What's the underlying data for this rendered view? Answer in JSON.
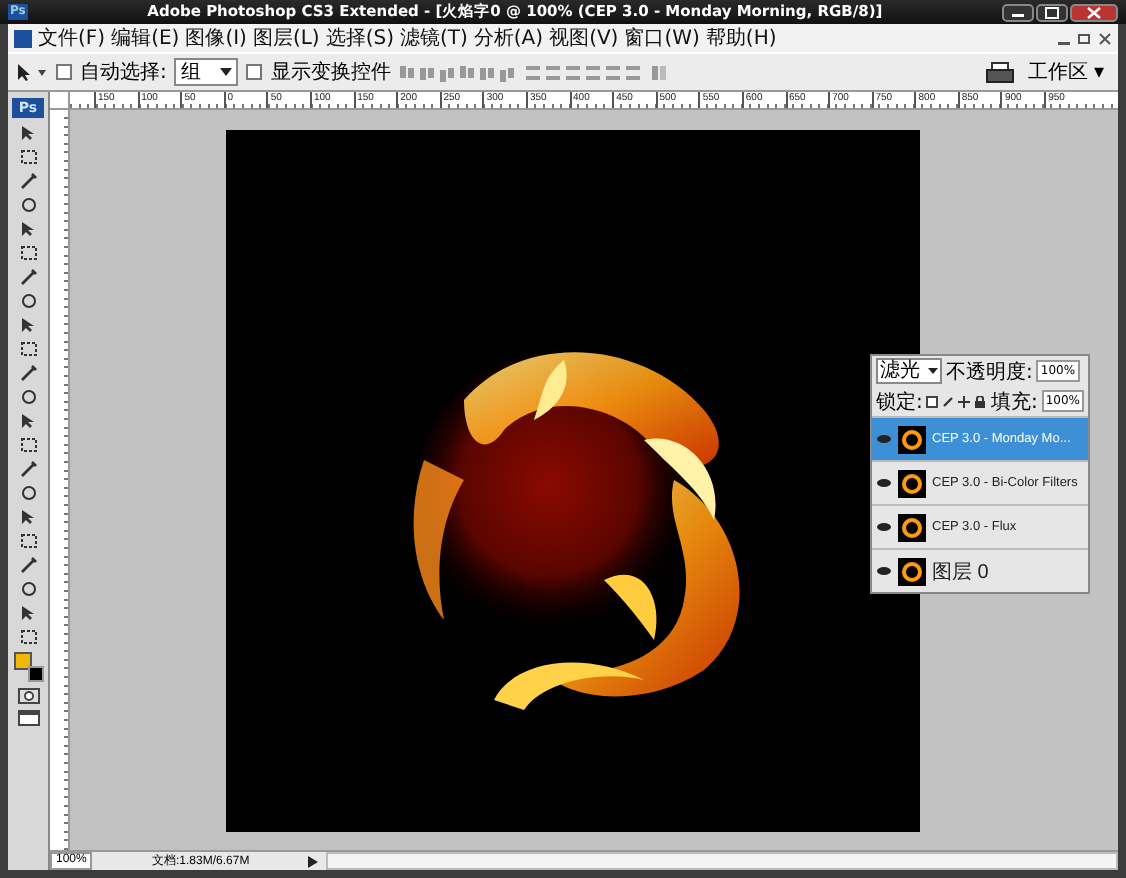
{
  "window": {
    "icon_label": "Ps",
    "title": "Adobe Photoshop CS3 Extended - [火焰字0 @ 100% (CEP 3.0 - Monday Morning, RGB/8)]"
  },
  "menu": [
    "文件(F)",
    "编辑(E)",
    "图像(I)",
    "图层(L)",
    "选择(S)",
    "滤镜(T)",
    "分析(A)",
    "视图(V)",
    "窗口(W)",
    "帮助(H)"
  ],
  "options_bar": {
    "auto_select": {
      "label": "自动选择:",
      "checked": false
    },
    "auto_select_target": "组",
    "show_transform": {
      "label": "显示变换控件",
      "checked": false
    },
    "workspace": "工作区 ▾"
  },
  "ruler": [
    "150",
    "100",
    "50",
    "0",
    "50",
    "100",
    "150",
    "200",
    "250",
    "300",
    "350",
    "400",
    "450",
    "500",
    "550",
    "600",
    "650",
    "700",
    "750",
    "800",
    "850",
    "900",
    "950"
  ],
  "toolbox": {
    "logo": "Ps",
    "swatches": [
      {
        "kind": "foreground",
        "color": "#f2b705"
      },
      {
        "kind": "background",
        "color": "#000000"
      }
    ]
  },
  "layers_panel": {
    "blend_mode": "滤光",
    "opacity_label": "不透明度:",
    "opacity": "100%",
    "lock_label": "锁定:",
    "fill_label": "填充:",
    "fill": "100%",
    "layers": [
      {
        "name": "CEP 3.0 - Monday Mo...",
        "selected": true,
        "visible": true
      },
      {
        "name": "CEP 3.0 - Bi-Color Filters",
        "selected": false,
        "visible": true
      },
      {
        "name": "CEP 3.0 - Flux",
        "selected": false,
        "visible": true
      },
      {
        "name": "图层 0",
        "selected": false,
        "visible": true
      }
    ]
  },
  "status_bar": {
    "zoom": "100%",
    "doc_info": "文档:1.83M/6.67M"
  }
}
